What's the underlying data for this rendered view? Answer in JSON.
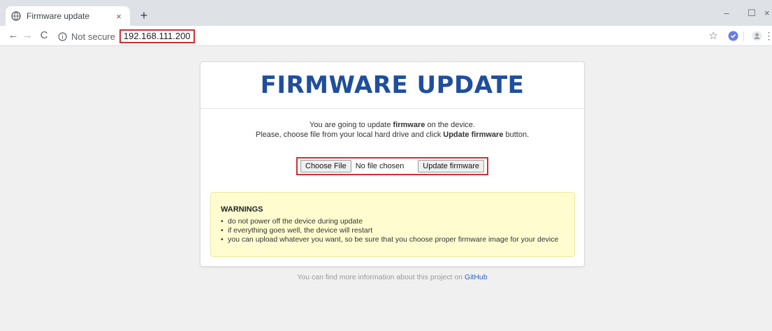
{
  "browser": {
    "tab": {
      "title": "Firmware update",
      "close_glyph": "×",
      "favicon": "globe-icon"
    },
    "new_tab_glyph": "+",
    "window_controls": {
      "minimize": "–",
      "maximize": "☐",
      "close": "×"
    },
    "toolbar": {
      "back": "←",
      "forward": "→",
      "reload": "C",
      "security_label": "Not secure",
      "url": "192.168.111.200",
      "star": "☆",
      "menu": "⋮"
    }
  },
  "page": {
    "title": "FIRMWARE UPDATE",
    "intro": {
      "line1_before": "You are going to update ",
      "line1_bold": "firmware",
      "line1_after": " on the device.",
      "line2_before": "Please, choose file from your local hard drive and click ",
      "line2_bold": "Update firmware",
      "line2_after": " button."
    },
    "upload": {
      "choose_file_label": "Choose File",
      "file_status": "No file chosen",
      "update_button_label": "Update firmware"
    },
    "warnings": {
      "title": "WARNINGS",
      "items": [
        "do not power off the device during update",
        "if everything goes well, the device will restart",
        "you can upload whatever you want, so be sure that you choose proper firmware image for your device"
      ]
    },
    "footer": {
      "text": "You can find more information about this project on ",
      "link": "GitHub"
    }
  },
  "colors": {
    "title": "#1f4e9c",
    "highlight_border": "#d32f2f",
    "warning_bg": "#fffdd0",
    "link": "#2a63b8"
  }
}
